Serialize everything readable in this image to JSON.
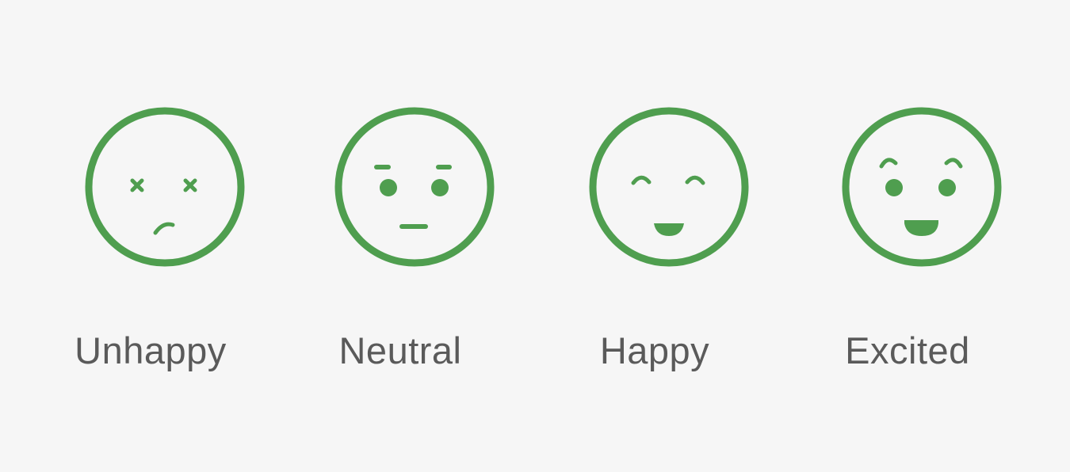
{
  "colors": {
    "background": "#f6f6f6",
    "icon_green": "#4f9e4f",
    "label_gray": "#5a5a5a"
  },
  "options": [
    {
      "label": "Unhappy",
      "icon": "unhappy-face-icon"
    },
    {
      "label": "Neutral",
      "icon": "neutral-face-icon"
    },
    {
      "label": "Happy",
      "icon": "happy-face-icon"
    },
    {
      "label": "Excited",
      "icon": "excited-face-icon"
    }
  ]
}
